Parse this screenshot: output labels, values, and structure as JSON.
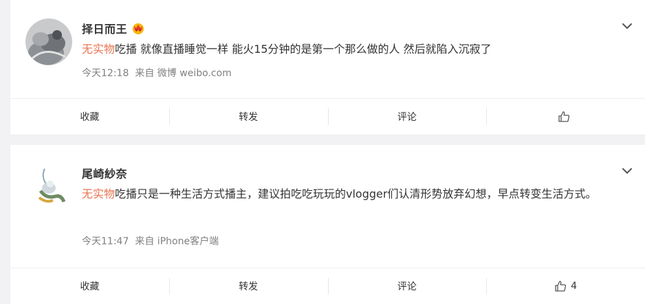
{
  "posts": [
    {
      "username": "择日而王",
      "badge": "crown-emoji",
      "hashtag": "无实物",
      "text": "吃播 就像直播睡觉一样 能火15分钟的是第一个那么做的人 然后就陷入沉寂了",
      "time": "今天12:18",
      "source": "来自 微博 weibo.com",
      "actions": {
        "collect": "收藏",
        "repost": "转发",
        "comment": "评论",
        "like_count": ""
      }
    },
    {
      "username": "尾崎紗奈",
      "hashtag": "无实物",
      "text": "吃播只是一种生活方式播主，建议拍吃吃玩玩的vlogger们认清形势放弃幻想，早点转变生活方式。",
      "time": "今天11:47",
      "source": "来自 iPhone客户端",
      "actions": {
        "collect": "收藏",
        "repost": "转发",
        "comment": "评论",
        "like_count": "4"
      }
    }
  ],
  "colors": {
    "background": "#f2f2f5",
    "card": "#ffffff",
    "hashtag": "#eb7350",
    "meta": "#808080",
    "text": "#333333"
  }
}
